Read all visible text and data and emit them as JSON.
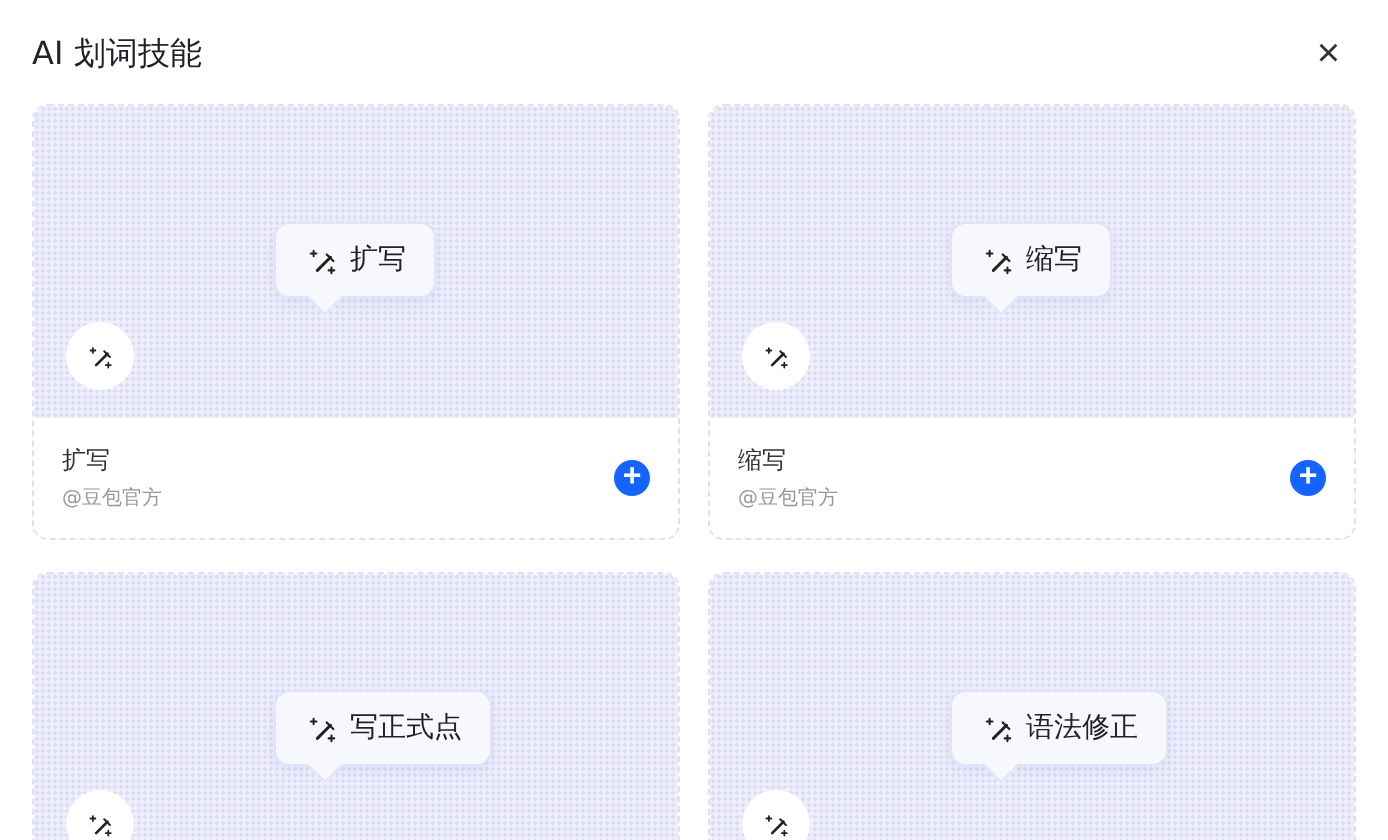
{
  "dialog": {
    "title": "AI 划词技能",
    "close": "×"
  },
  "skills": [
    {
      "bubble": "扩写",
      "name": "扩写",
      "author": "@豆包官方",
      "add": "+"
    },
    {
      "bubble": "缩写",
      "name": "缩写",
      "author": "@豆包官方",
      "add": "+"
    },
    {
      "bubble": "写正式点"
    },
    {
      "bubble": "语法修正"
    }
  ]
}
